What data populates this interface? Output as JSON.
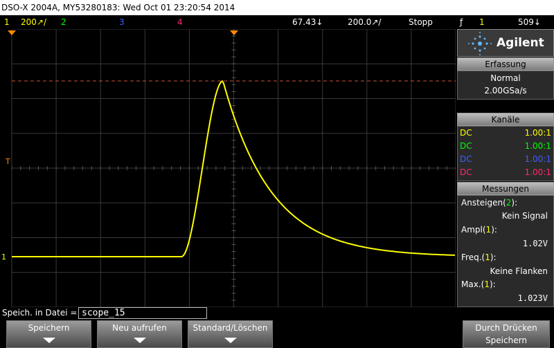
{
  "title": "DSO-X 2004A, MY53280183: Wed Oct 01 23:20:54 2014",
  "status": {
    "ch1_num": "1",
    "ch1_scale": "200↗/",
    "ch2_num": "2",
    "ch3_num": "3",
    "ch4_num": "4",
    "timebase": "67.43↓",
    "time_per_div": "200.0↗/",
    "run_state": "Stopp",
    "trig_icon": "ƒ",
    "trig_src": "1",
    "trig_level": "509↓"
  },
  "colors": {
    "ch1": "#ffff00",
    "ch2": "#00ff00",
    "ch3": "#3f5fff",
    "ch4": "#ff2a6a",
    "orange": "#ff8a00"
  },
  "brand": "Agilent",
  "acquisition": {
    "header": "Erfassung",
    "mode": "Normal",
    "rate": "2.00GSa/s"
  },
  "channels": {
    "header": "Kanäle",
    "items": [
      {
        "coupling": "DC",
        "probe": "1.00:1"
      },
      {
        "coupling": "DC",
        "probe": "1.00:1"
      },
      {
        "coupling": "DC",
        "probe": "1.00:1"
      },
      {
        "coupling": "DC",
        "probe": "1.00:1"
      }
    ]
  },
  "measurements": {
    "header": "Messungen",
    "items": [
      {
        "label": "Ansteigen",
        "src": "2",
        "value": "Kein Signal"
      },
      {
        "label": "Ampl",
        "src": "1",
        "value": "1.02V"
      },
      {
        "label": "Freq.",
        "src": "1",
        "value": "Keine Flanken"
      },
      {
        "label": "Max.",
        "src": "1",
        "value": "1.023V"
      }
    ]
  },
  "save": {
    "label": "Speich. in Datei =",
    "value": "scope_15"
  },
  "softkeys": [
    {
      "label": "Speichern"
    },
    {
      "label": "Neu aufrufen"
    },
    {
      "label": "Standard/Löschen"
    },
    {
      "label": "Durch Drücken",
      "label2": "Speichern"
    }
  ],
  "markers": {
    "trigger_label": "T",
    "ground_label": "1"
  }
}
